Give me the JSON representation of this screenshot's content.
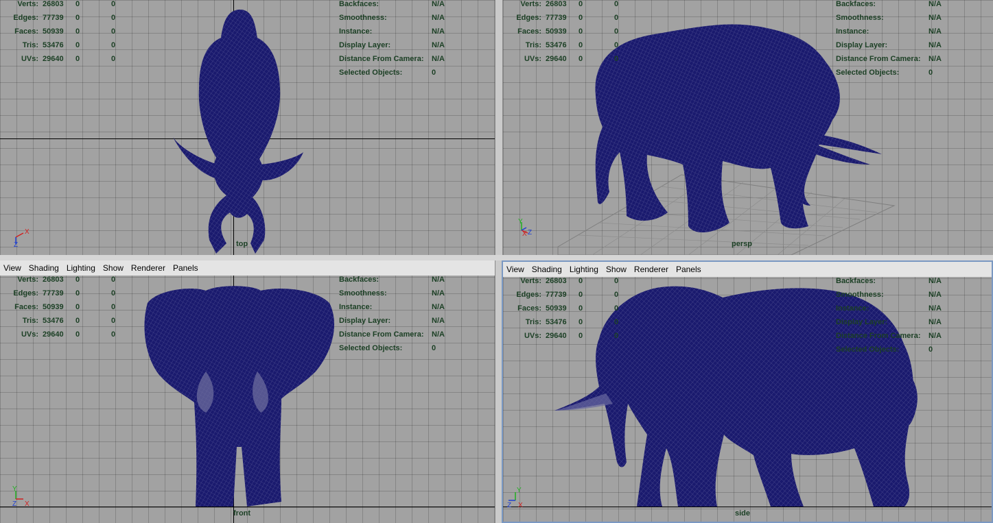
{
  "menubar": [
    "View",
    "Shading",
    "Lighting",
    "Show",
    "Renderer",
    "Panels"
  ],
  "hud_left": [
    {
      "label": "Verts:",
      "value": "26803",
      "sel": "0",
      "comp": "0"
    },
    {
      "label": "Edges:",
      "value": "77739",
      "sel": "0",
      "comp": "0"
    },
    {
      "label": "Faces:",
      "value": "50939",
      "sel": "0",
      "comp": "0"
    },
    {
      "label": "Tris:",
      "value": "53476",
      "sel": "0",
      "comp": "0"
    },
    {
      "label": "UVs:",
      "value": "29640",
      "sel": "0",
      "comp": "0"
    }
  ],
  "hud_right": [
    {
      "label": "Backfaces:",
      "value": "N/A"
    },
    {
      "label": "Smoothness:",
      "value": "N/A"
    },
    {
      "label": "Instance:",
      "value": "N/A"
    },
    {
      "label": "Display Layer:",
      "value": "N/A"
    },
    {
      "label": "Distance From Camera:",
      "value": "N/A"
    },
    {
      "label": "Selected Objects:",
      "value": "0"
    }
  ],
  "viewports": {
    "top": "top",
    "persp": "persp",
    "front": "front",
    "side": "side"
  },
  "gizmo": {
    "x": "X",
    "y": "Y",
    "z": "Z"
  },
  "colors": {
    "viewport_bg": "#a2a2a2",
    "mesh": "#1a1a6e",
    "hud_text": "#1b3f24",
    "active_border": "#7a98c2"
  }
}
